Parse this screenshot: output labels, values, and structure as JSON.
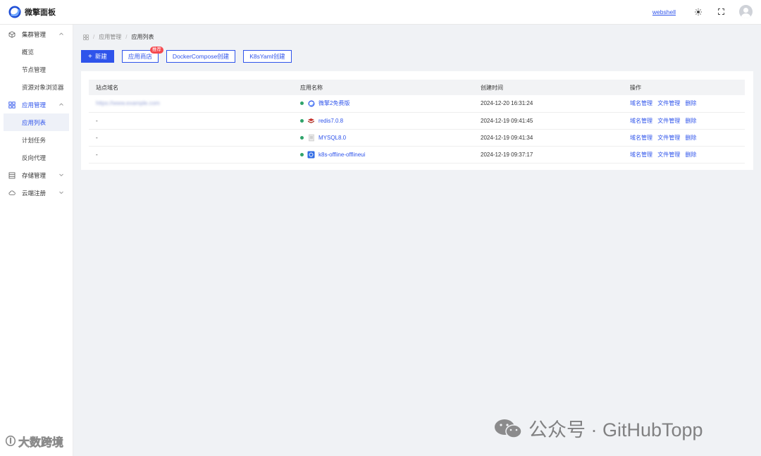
{
  "app": {
    "title": "微擎面板"
  },
  "header": {
    "username": "webshell",
    "theme_icon": "sun-icon",
    "fullscreen_icon": "fullscreen-icon",
    "avatar_icon": "user-avatar-icon"
  },
  "sidebar": {
    "groups": [
      {
        "label": "集群管理",
        "icon": "cube-icon",
        "expanded": true,
        "items": [
          "概览",
          "节点管理",
          "资源对象浏览器"
        ]
      },
      {
        "label": "应用管理",
        "icon": "grid-icon",
        "expanded": true,
        "items": [
          "应用列表",
          "计划任务",
          "反向代理"
        ],
        "selected": "应用列表"
      },
      {
        "label": "存储管理",
        "icon": "storage-icon",
        "expanded": false,
        "items": []
      },
      {
        "label": "云端注册",
        "icon": "cloud-icon",
        "expanded": false,
        "items": []
      }
    ]
  },
  "breadcrumb": {
    "home_icon": "grid-icon",
    "items": [
      "应用管理",
      "应用列表"
    ]
  },
  "toolbar": {
    "new_label": "新建",
    "store_label": "应用商店",
    "store_badge": "推荐",
    "compose_label": "DockerCompose创建",
    "k8s_label": "K8sYaml创建"
  },
  "table": {
    "columns": [
      "站点域名",
      "应用名称",
      "创建时间",
      "操作"
    ],
    "rows": [
      {
        "domain": "https://www.example.com",
        "app": "微擎2免费版",
        "icon": "w7-icon",
        "created": "2024-12-20 16:31:24",
        "status": "running"
      },
      {
        "domain": "-",
        "app": "redis7.0.8",
        "icon": "redis-icon",
        "created": "2024-12-19 09:41:45",
        "status": "running"
      },
      {
        "domain": "-",
        "app": "MYSQL8.0",
        "icon": "mysql-icon",
        "created": "2024-12-19 09:41:34",
        "status": "running"
      },
      {
        "domain": "-",
        "app": "k8s-offline-offlineui",
        "icon": "k8s-icon",
        "created": "2024-12-19 09:37:17",
        "status": "running"
      }
    ],
    "actions": [
      "域名管理",
      "文件管理",
      "删除"
    ]
  },
  "watermarks": {
    "left": "大数跨境",
    "right": "公众号 · GitHubTopp"
  },
  "colors": {
    "accent": "#2f54eb",
    "status_running": "#2fa36a",
    "badge": "#f5484e"
  }
}
